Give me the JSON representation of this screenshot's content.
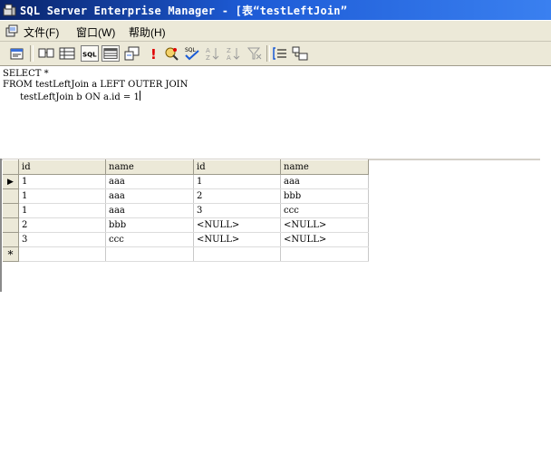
{
  "window": {
    "title": "SQL Server Enterprise Manager - [表“testLeftJoin”"
  },
  "menu": {
    "items": [
      {
        "label": "文件(F)"
      },
      {
        "label": "窗口(W)"
      },
      {
        "label": "帮助(H)"
      }
    ]
  },
  "toolbar": {
    "buttons": [
      {
        "icon": "properties-icon"
      },
      {
        "icon": "show-diagram-pane-icon"
      },
      {
        "icon": "show-grid-pane-icon"
      },
      {
        "icon": "show-sql-pane-icon",
        "label": "SQL",
        "pressed": true
      },
      {
        "icon": "show-results-pane-icon",
        "pressed": true
      },
      {
        "icon": "change-query-type-icon"
      },
      {
        "icon": "run-icon",
        "label": "!"
      },
      {
        "icon": "cancel-query-icon"
      },
      {
        "icon": "verify-sql-icon",
        "label": "SQL"
      },
      {
        "icon": "sort-ascending-icon"
      },
      {
        "icon": "sort-descending-icon"
      },
      {
        "icon": "remove-filter-icon"
      },
      {
        "icon": "group-by-icon"
      },
      {
        "icon": "add-table-icon"
      }
    ]
  },
  "sql": {
    "lines": [
      "SELECT *",
      "FROM testLeftJoin a LEFT OUTER JOIN",
      "      testLeftJoin b ON a.id = 1"
    ]
  },
  "grid": {
    "columns": [
      "id",
      "name",
      "id",
      "name"
    ],
    "rows": [
      [
        "1",
        "aaa",
        "1",
        "aaa"
      ],
      [
        "1",
        "aaa",
        "2",
        "bbb"
      ],
      [
        "1",
        "aaa",
        "3",
        "ccc"
      ],
      [
        "2",
        "bbb",
        "<NULL>",
        "<NULL>"
      ],
      [
        "3",
        "ccc",
        "<NULL>",
        "<NULL>"
      ]
    ],
    "current_row_marker": "▶",
    "new_row_marker": "*"
  },
  "colors": {
    "titlebar_start": "#0a246a",
    "titlebar_end": "#3a80f0",
    "chrome": "#ece9d8",
    "run_button": "#e00000"
  }
}
